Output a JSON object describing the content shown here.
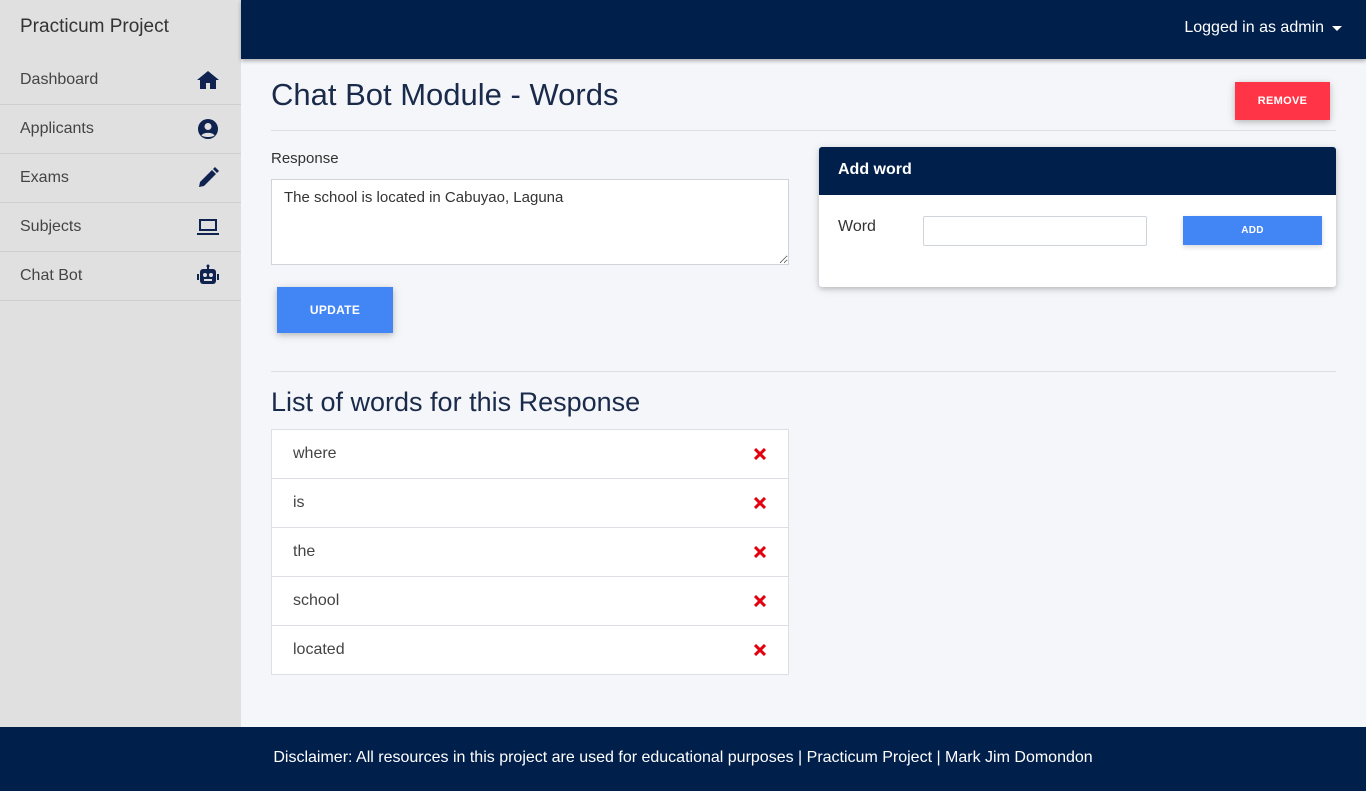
{
  "sidebar": {
    "brand": "Practicum Project",
    "items": [
      {
        "label": "Dashboard",
        "icon": "home-icon"
      },
      {
        "label": "Applicants",
        "icon": "user-circle-icon"
      },
      {
        "label": "Exams",
        "icon": "pencil-icon"
      },
      {
        "label": "Subjects",
        "icon": "laptop-icon"
      },
      {
        "label": "Chat Bot",
        "icon": "robot-icon"
      }
    ]
  },
  "topbar": {
    "user_menu": "Logged in as admin"
  },
  "main": {
    "title": "Chat Bot Module - Words",
    "remove_label": "REMOVE",
    "response_label": "Response",
    "response_value": "The school is located in Cabuyao, Laguna",
    "update_label": "UPDATE",
    "add_card": {
      "title": "Add word",
      "word_label": "Word",
      "word_value": "",
      "add_label": "ADD"
    },
    "list_title": "List of words for this Response",
    "words": [
      "where",
      "is",
      "the",
      "school",
      "located"
    ]
  },
  "footer": {
    "text": "Disclaimer: All resources in this project are used for educational purposes | Practicum Project | Mark Jim Domondon"
  },
  "colors": {
    "navy": "#011f4b",
    "danger": "#ff3547",
    "primary": "#4285f4",
    "delete_icon": "#e3000f"
  }
}
